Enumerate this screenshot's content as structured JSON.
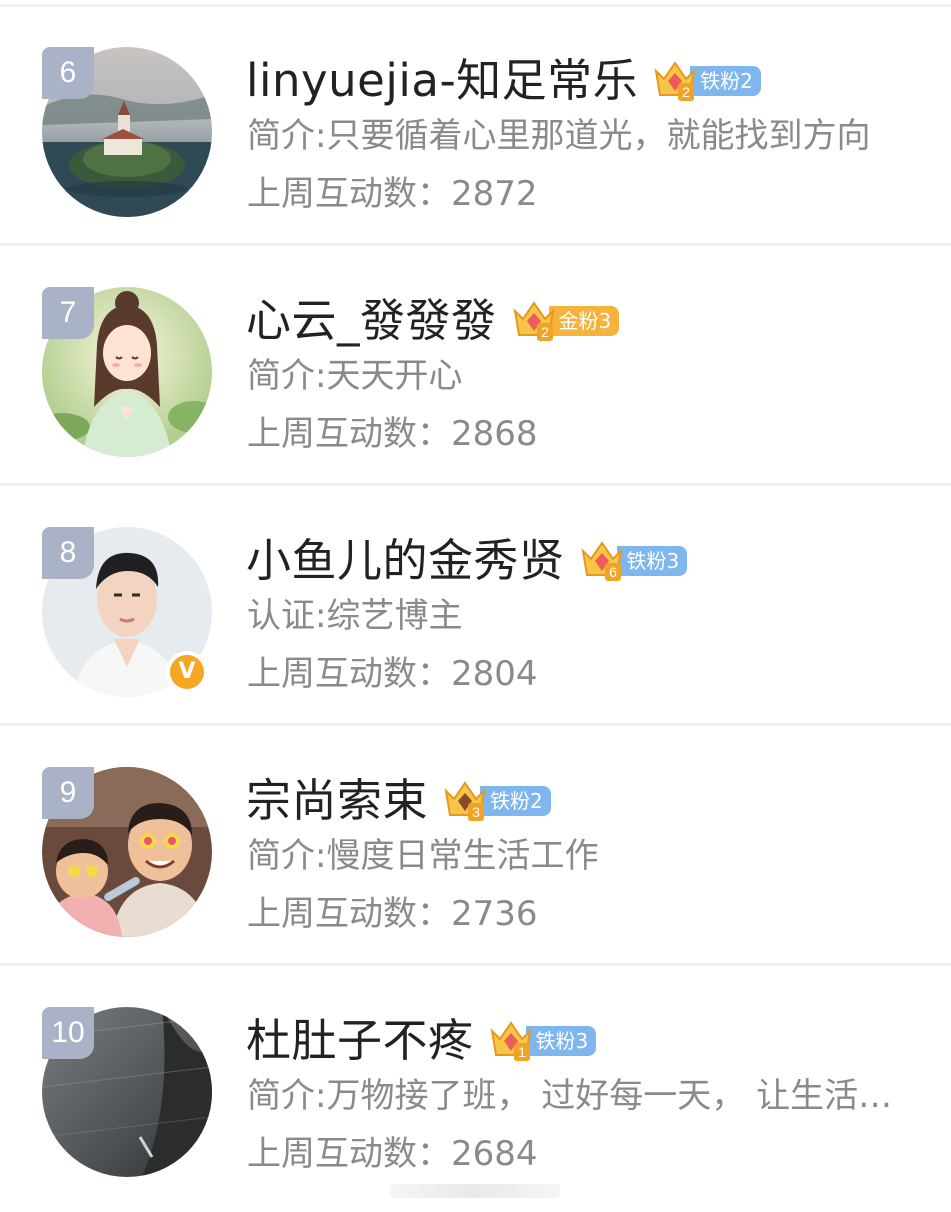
{
  "colors": {
    "rank_badge": "#a9b2c6",
    "name_text": "#222222",
    "secondary_text": "#8a8a8a",
    "iron_fan_pill": "#7fb6ee",
    "gold_fan_pill": "#f5b23c",
    "verified_badge": "#f5a623"
  },
  "users": [
    {
      "rank": "6",
      "name": "linyuejia-知足常乐",
      "crown_icon": "crown-icon",
      "crown_level": "2",
      "fan_label": "铁粉2",
      "fan_type": "iron",
      "intro": "简介:只要循着心里那道光，就能找到方向",
      "interact": "上周互动数：2872",
      "avatar": "island-castle-photo",
      "verified": false
    },
    {
      "rank": "7",
      "name": "心云_發發發",
      "crown_icon": "crown-icon",
      "crown_level": "2",
      "fan_label": "金粉3",
      "fan_type": "gold",
      "intro": "简介:天天开心",
      "interact": "上周互动数：2868",
      "avatar": "anime-girl-illustration",
      "verified": false
    },
    {
      "rank": "8",
      "name": "小鱼儿的金秀贤",
      "crown_icon": "crown-icon",
      "crown_level": "6",
      "fan_label": "铁粉3",
      "fan_type": "iron",
      "intro": "认证:综艺博主",
      "interact": "上周互动数：2804",
      "avatar": "man-portrait-photo",
      "verified": true,
      "verified_mark": "V"
    },
    {
      "rank": "9",
      "name": "宗尚索束",
      "crown_icon": "crown-icon",
      "crown_level": "3",
      "fan_label": "铁粉2",
      "fan_type": "iron",
      "intro": "简介:慢度日常生活工作",
      "interact": "上周互动数：2736",
      "avatar": "cartoon-family-illustration",
      "verified": false
    },
    {
      "rank": "10",
      "name": "杜肚子不疼",
      "crown_icon": "crown-icon",
      "crown_level": "1",
      "fan_label": "铁粉3",
      "fan_type": "iron",
      "intro": "简介:万物接了班， 过好每一天， 让生活…",
      "interact": "上周互动数：2684",
      "avatar": "dark-rain-photo",
      "verified": false
    }
  ]
}
